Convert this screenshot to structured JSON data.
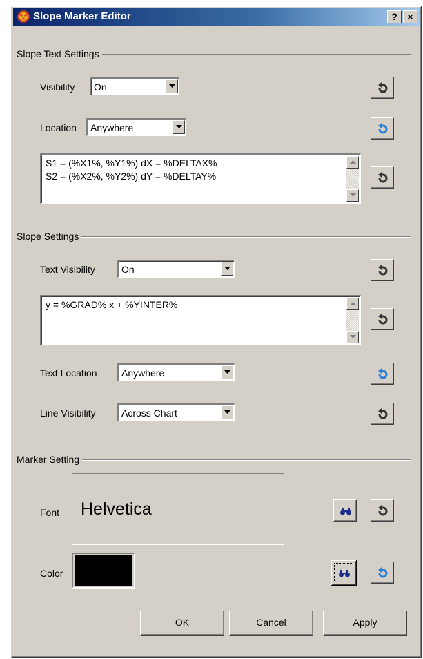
{
  "window": {
    "title": "Slope Marker Editor",
    "help_label": "?",
    "close_label": "×"
  },
  "slope_text_settings": {
    "group_label": "Slope Text Settings",
    "visibility_label": "Visibility",
    "visibility_value": "On",
    "location_label": "Location",
    "location_value": "Anywhere",
    "text_lines": [
      "S1 = (%X1%, %Y1%) dX = %DELTAX%",
      "S2 = (%X2%, %Y2%) dY = %DELTAY%"
    ]
  },
  "slope_settings": {
    "group_label": "Slope Settings",
    "text_visibility_label": "Text Visibility",
    "text_visibility_value": "On",
    "equation": "y = %GRAD% x + %YINTER%",
    "text_location_label": "Text Location",
    "text_location_value": "Anywhere",
    "line_visibility_label": "Line Visibility",
    "line_visibility_value": "Across Chart"
  },
  "marker_setting": {
    "group_label": "Marker Setting",
    "font_label": "Font",
    "font_preview": "Helvetica",
    "color_label": "Color",
    "color_value": "#000000"
  },
  "buttons": {
    "ok": "OK",
    "cancel": "Cancel",
    "apply": "Apply"
  },
  "icons": {
    "revert": "revert-icon",
    "browse": "binoculars-icon",
    "app": "app-icon"
  },
  "colors": {
    "title_start": "#0a246a",
    "title_end": "#a6caf0",
    "face": "#d4d0c8",
    "revert_active": "#2a7fd4",
    "revert_inactive": "#333333"
  }
}
